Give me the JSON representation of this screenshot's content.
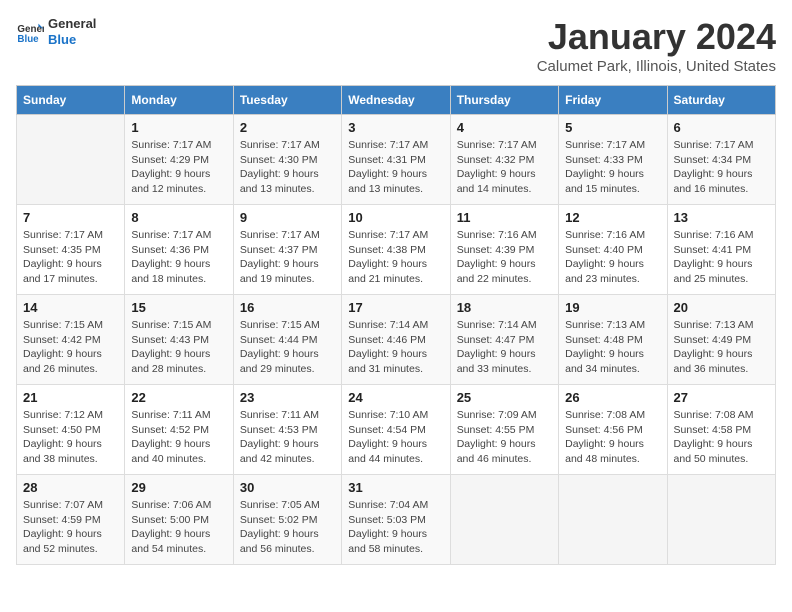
{
  "logo": {
    "text_general": "General",
    "text_blue": "Blue"
  },
  "title": "January 2024",
  "subtitle": "Calumet Park, Illinois, United States",
  "days_of_week": [
    "Sunday",
    "Monday",
    "Tuesday",
    "Wednesday",
    "Thursday",
    "Friday",
    "Saturday"
  ],
  "weeks": [
    [
      {
        "day": "",
        "empty": true
      },
      {
        "day": "1",
        "sunrise": "7:17 AM",
        "sunset": "4:29 PM",
        "daylight": "9 hours and 12 minutes."
      },
      {
        "day": "2",
        "sunrise": "7:17 AM",
        "sunset": "4:30 PM",
        "daylight": "9 hours and 13 minutes."
      },
      {
        "day": "3",
        "sunrise": "7:17 AM",
        "sunset": "4:31 PM",
        "daylight": "9 hours and 13 minutes."
      },
      {
        "day": "4",
        "sunrise": "7:17 AM",
        "sunset": "4:32 PM",
        "daylight": "9 hours and 14 minutes."
      },
      {
        "day": "5",
        "sunrise": "7:17 AM",
        "sunset": "4:33 PM",
        "daylight": "9 hours and 15 minutes."
      },
      {
        "day": "6",
        "sunrise": "7:17 AM",
        "sunset": "4:34 PM",
        "daylight": "9 hours and 16 minutes."
      }
    ],
    [
      {
        "day": "7",
        "sunrise": "7:17 AM",
        "sunset": "4:35 PM",
        "daylight": "9 hours and 17 minutes."
      },
      {
        "day": "8",
        "sunrise": "7:17 AM",
        "sunset": "4:36 PM",
        "daylight": "9 hours and 18 minutes."
      },
      {
        "day": "9",
        "sunrise": "7:17 AM",
        "sunset": "4:37 PM",
        "daylight": "9 hours and 19 minutes."
      },
      {
        "day": "10",
        "sunrise": "7:17 AM",
        "sunset": "4:38 PM",
        "daylight": "9 hours and 21 minutes."
      },
      {
        "day": "11",
        "sunrise": "7:16 AM",
        "sunset": "4:39 PM",
        "daylight": "9 hours and 22 minutes."
      },
      {
        "day": "12",
        "sunrise": "7:16 AM",
        "sunset": "4:40 PM",
        "daylight": "9 hours and 23 minutes."
      },
      {
        "day": "13",
        "sunrise": "7:16 AM",
        "sunset": "4:41 PM",
        "daylight": "9 hours and 25 minutes."
      }
    ],
    [
      {
        "day": "14",
        "sunrise": "7:15 AM",
        "sunset": "4:42 PM",
        "daylight": "9 hours and 26 minutes."
      },
      {
        "day": "15",
        "sunrise": "7:15 AM",
        "sunset": "4:43 PM",
        "daylight": "9 hours and 28 minutes."
      },
      {
        "day": "16",
        "sunrise": "7:15 AM",
        "sunset": "4:44 PM",
        "daylight": "9 hours and 29 minutes."
      },
      {
        "day": "17",
        "sunrise": "7:14 AM",
        "sunset": "4:46 PM",
        "daylight": "9 hours and 31 minutes."
      },
      {
        "day": "18",
        "sunrise": "7:14 AM",
        "sunset": "4:47 PM",
        "daylight": "9 hours and 33 minutes."
      },
      {
        "day": "19",
        "sunrise": "7:13 AM",
        "sunset": "4:48 PM",
        "daylight": "9 hours and 34 minutes."
      },
      {
        "day": "20",
        "sunrise": "7:13 AM",
        "sunset": "4:49 PM",
        "daylight": "9 hours and 36 minutes."
      }
    ],
    [
      {
        "day": "21",
        "sunrise": "7:12 AM",
        "sunset": "4:50 PM",
        "daylight": "9 hours and 38 minutes."
      },
      {
        "day": "22",
        "sunrise": "7:11 AM",
        "sunset": "4:52 PM",
        "daylight": "9 hours and 40 minutes."
      },
      {
        "day": "23",
        "sunrise": "7:11 AM",
        "sunset": "4:53 PM",
        "daylight": "9 hours and 42 minutes."
      },
      {
        "day": "24",
        "sunrise": "7:10 AM",
        "sunset": "4:54 PM",
        "daylight": "9 hours and 44 minutes."
      },
      {
        "day": "25",
        "sunrise": "7:09 AM",
        "sunset": "4:55 PM",
        "daylight": "9 hours and 46 minutes."
      },
      {
        "day": "26",
        "sunrise": "7:08 AM",
        "sunset": "4:56 PM",
        "daylight": "9 hours and 48 minutes."
      },
      {
        "day": "27",
        "sunrise": "7:08 AM",
        "sunset": "4:58 PM",
        "daylight": "9 hours and 50 minutes."
      }
    ],
    [
      {
        "day": "28",
        "sunrise": "7:07 AM",
        "sunset": "4:59 PM",
        "daylight": "9 hours and 52 minutes."
      },
      {
        "day": "29",
        "sunrise": "7:06 AM",
        "sunset": "5:00 PM",
        "daylight": "9 hours and 54 minutes."
      },
      {
        "day": "30",
        "sunrise": "7:05 AM",
        "sunset": "5:02 PM",
        "daylight": "9 hours and 56 minutes."
      },
      {
        "day": "31",
        "sunrise": "7:04 AM",
        "sunset": "5:03 PM",
        "daylight": "9 hours and 58 minutes."
      },
      {
        "day": "",
        "empty": true
      },
      {
        "day": "",
        "empty": true
      },
      {
        "day": "",
        "empty": true
      }
    ]
  ],
  "labels": {
    "sunrise_prefix": "Sunrise: ",
    "sunset_prefix": "Sunset: ",
    "daylight_prefix": "Daylight: "
  }
}
